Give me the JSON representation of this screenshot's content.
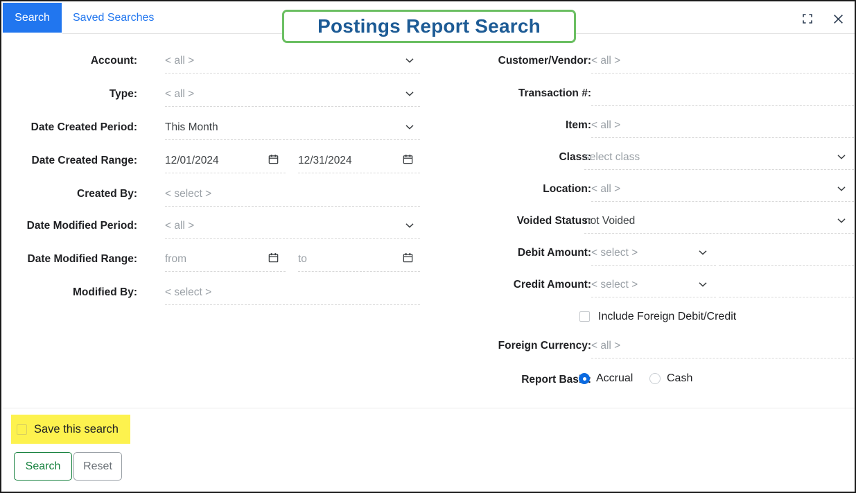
{
  "window": {
    "tabs": [
      {
        "label": "Search",
        "active": true
      },
      {
        "label": "Saved Searches",
        "active": false
      }
    ],
    "title": "Postings Report Search",
    "expand_icon": "expand-icon",
    "close_icon": "close-icon"
  },
  "colors": {
    "tab_active_bg": "#2176ef",
    "tab_link": "#2176ef",
    "title_text": "#1d5b95",
    "title_border": "#6bbf62",
    "highlight": "#fdf24e",
    "search_btn": "#15803d",
    "reset_btn": "#6b7177",
    "radio_on": "#0b6ae0"
  },
  "left_fields": [
    {
      "label": "Account:",
      "value": "< all >",
      "placeholder": true,
      "control": "dropdown"
    },
    {
      "label": "Type:",
      "value": "< all >",
      "placeholder": true,
      "control": "dropdown"
    },
    {
      "label": "Date Created Period:",
      "value": "This Month",
      "placeholder": false,
      "control": "dropdown"
    },
    {
      "label": "Date Created Range:",
      "from": "12/01/2024",
      "to": "12/31/2024",
      "from_placeholder": false,
      "to_placeholder": false,
      "control": "date-range"
    },
    {
      "label": "Created By:",
      "value": "< select >",
      "placeholder": true,
      "control": "text"
    },
    {
      "label": "Date Modified Period:",
      "value": "< all >",
      "placeholder": true,
      "control": "dropdown"
    },
    {
      "label": "Date Modified Range:",
      "from": "from",
      "to": "to",
      "from_placeholder": true,
      "to_placeholder": true,
      "control": "date-range"
    },
    {
      "label": "Modified By:",
      "value": "< select >",
      "placeholder": true,
      "control": "text"
    }
  ],
  "right_fields": [
    {
      "label": "Customer/Vendor:",
      "value": "< all >",
      "placeholder": true,
      "control": "text"
    },
    {
      "label": "Transaction #:",
      "value": "",
      "placeholder": true,
      "control": "text"
    },
    {
      "label": "Item:",
      "value": "< all >",
      "placeholder": true,
      "control": "text"
    },
    {
      "label": "Class:",
      "value": "select class",
      "placeholder": true,
      "control": "dropdown"
    },
    {
      "label": "Location:",
      "value": "< all >",
      "placeholder": true,
      "control": "dropdown"
    },
    {
      "label": "Voided Status:",
      "value": "not Voided",
      "placeholder": false,
      "control": "dropdown"
    },
    {
      "label": "Debit Amount:",
      "value": "< select >",
      "placeholder": true,
      "control": "dropdown-plus-value",
      "value2": ""
    },
    {
      "label": "Credit Amount:",
      "value": "< select >",
      "placeholder": true,
      "control": "dropdown-plus-value",
      "value2": ""
    }
  ],
  "foreign": {
    "checkbox_label": "Include Foreign Debit/Credit",
    "checked": false,
    "currency_label": "Foreign Currency:",
    "currency_value": "< all >"
  },
  "report_basis": {
    "label": "Report Basis:",
    "options": [
      {
        "label": "Accrual",
        "selected": true
      },
      {
        "label": "Cash",
        "selected": false
      }
    ]
  },
  "footer": {
    "save_search_label": "Save this search",
    "save_search_checked": false,
    "search_label": "Search",
    "reset_label": "Reset"
  }
}
